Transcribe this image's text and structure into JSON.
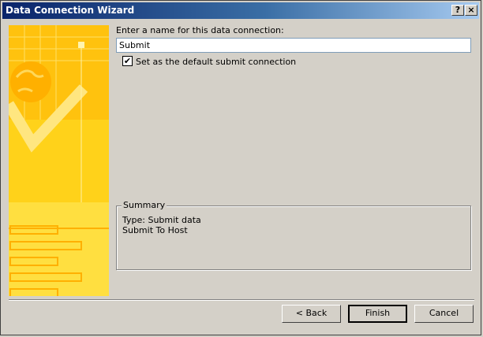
{
  "window": {
    "title": "Data Connection Wizard",
    "help_label": "?",
    "close_label": "×"
  },
  "form": {
    "name_label": "Enter a name for this data connection:",
    "name_value": "Submit",
    "default_checkbox_label": "Set as the default submit connection",
    "default_checked": true,
    "check_glyph": "✔"
  },
  "summary": {
    "legend": "Summary",
    "lines": [
      "Type: Submit data",
      "Submit To Host"
    ]
  },
  "buttons": {
    "back": "< Back",
    "finish": "Finish",
    "cancel": "Cancel"
  },
  "colors": {
    "banner": "#ffd21a",
    "title_start": "#0a246a",
    "title_end": "#a6caf0"
  }
}
